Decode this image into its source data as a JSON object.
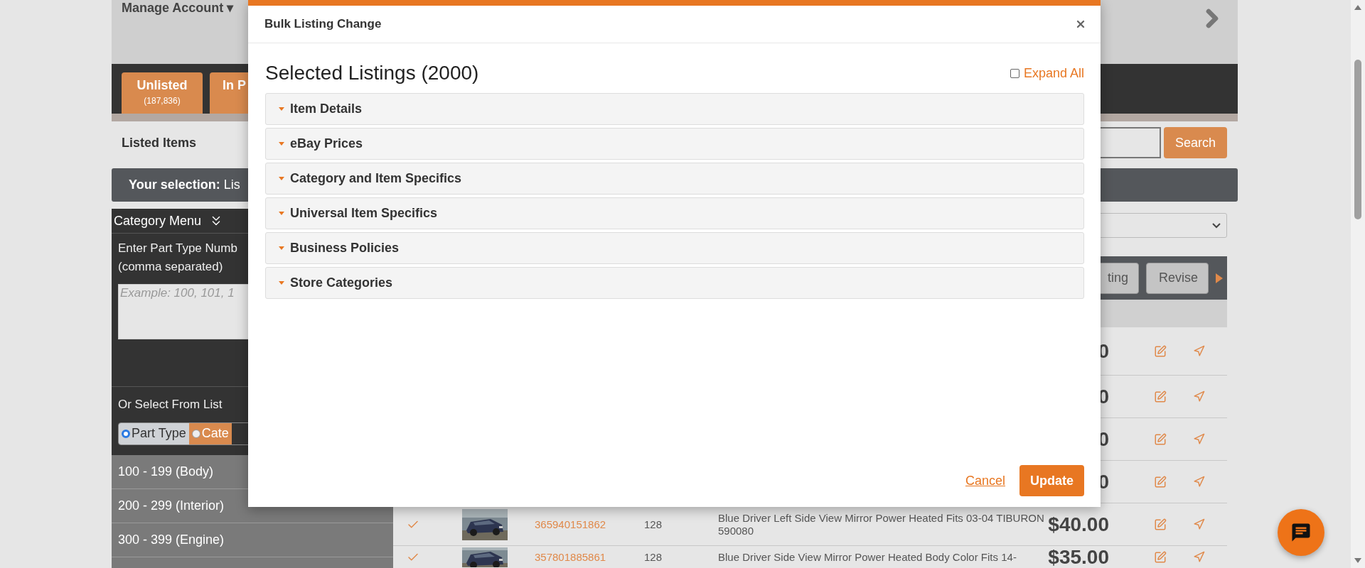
{
  "header": {
    "account_menu": "Manage Account ▾"
  },
  "tabs": [
    {
      "label": "Unlisted",
      "count": "(187,836)"
    },
    {
      "label": "In P"
    }
  ],
  "listed_items": {
    "title": "Listed Items",
    "search_button": "Search"
  },
  "selection_bar": "**Your selection:** Lis",
  "sidebar": {
    "menu_title": "Category Menu",
    "part_type_label": "Enter Part Type Numb (comma separated)",
    "placeholder": "Example: 100, 101, 1",
    "select_label": "Or Select From List",
    "radio_options": [
      {
        "label": "Part Type",
        "selected": true
      },
      {
        "label": "Cate",
        "selected": false
      }
    ],
    "items": [
      "100 - 199 (Body)",
      "200 - 299 (Interior)",
      "300 - 399 (Engine)"
    ]
  },
  "toolbar": {
    "buttons": [
      "ting",
      "Revise"
    ]
  },
  "rows": [
    {
      "price": "0"
    },
    {
      "price": "0"
    },
    {
      "price": "0"
    },
    {
      "price": "0"
    },
    {
      "checked": true,
      "listing_id": "365940151862",
      "quantity": "128",
      "title": "Blue Driver Left Side View Mirror Power Heated Fits 03-04 TIBURON 590080",
      "price": "$40.00"
    },
    {
      "checked": true,
      "listing_id": "357801885861",
      "quantity": "128",
      "title": "Blue Driver Side View Mirror Power Heated Body Color Fits 14-",
      "price": "$35.00"
    }
  ],
  "modal": {
    "title": "Bulk Listing Change",
    "heading": "Selected Listings (2000)",
    "expand_all": {
      "label": "Expand All",
      "checked": false
    },
    "sections": [
      "Item Details",
      "eBay Prices",
      "Category and Item Specifics",
      "Universal Item Specifics",
      "Business Policies",
      "Store Categories"
    ],
    "cancel": "Cancel",
    "update": "Update"
  }
}
